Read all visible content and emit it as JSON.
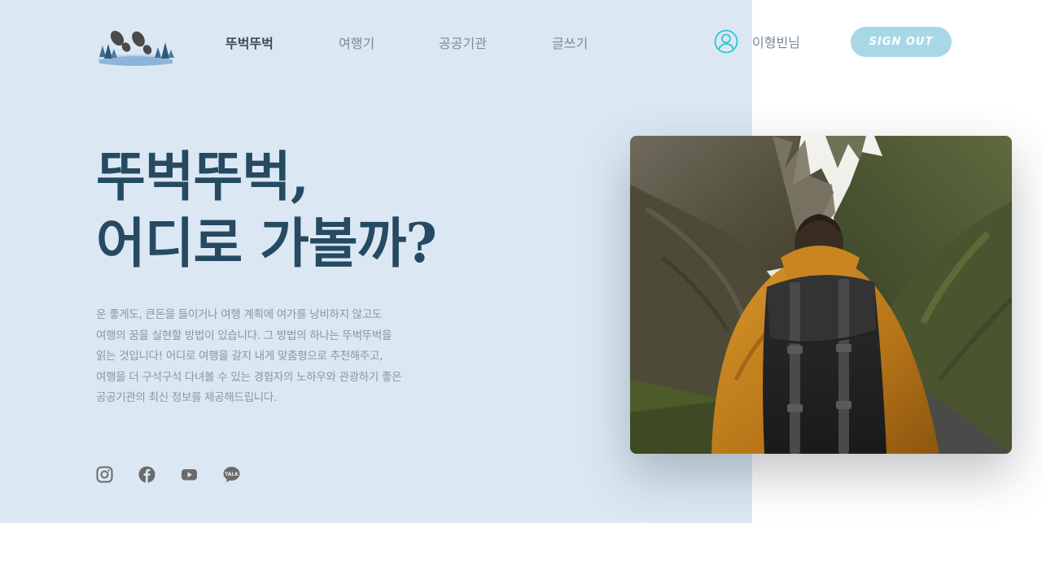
{
  "header": {
    "logo_name": "footprints-logo",
    "nav": [
      {
        "label": "뚜벅뚜벅",
        "active": true
      },
      {
        "label": "여행기",
        "active": false
      },
      {
        "label": "공공기관",
        "active": false
      },
      {
        "label": "글쓰기",
        "active": false
      }
    ],
    "user": {
      "icon": "user-icon",
      "name": "이형빈님"
    },
    "signout_label": "SIGN OUT"
  },
  "hero": {
    "title_line1": "뚜벅뚜벅,",
    "title_line2": "어디로 가볼까?",
    "description": "운 좋게도, 큰돈을 들이거나 여행 계획에 여가를 낭비하지 않고도 여행의 꿈을 실현할 방법이 있습니다. 그 방법의 하나는 뚜벅뚜벅을 읽는 것입니다! 어디로 여행을 갈지 내게 맞춤형으로 추천해주고, 여행을 더 구석구석 다녀볼 수 있는 경험자의 노하우와 관광하기 좋은 공공기관의 최신 정보를 제공해드립니다.",
    "image_subject": "hiker-with-backpack-photo"
  },
  "social": [
    {
      "name": "instagram-icon"
    },
    {
      "name": "facebook-icon"
    },
    {
      "name": "youtube-icon"
    },
    {
      "name": "kakaotalk-icon",
      "label": "TALK"
    }
  ],
  "colors": {
    "hero_bg": "#dbe8f4",
    "headline": "#254a62",
    "button": "#a8d8e6",
    "user_icon": "#31c4d6",
    "body_text": "#8a96a0"
  }
}
